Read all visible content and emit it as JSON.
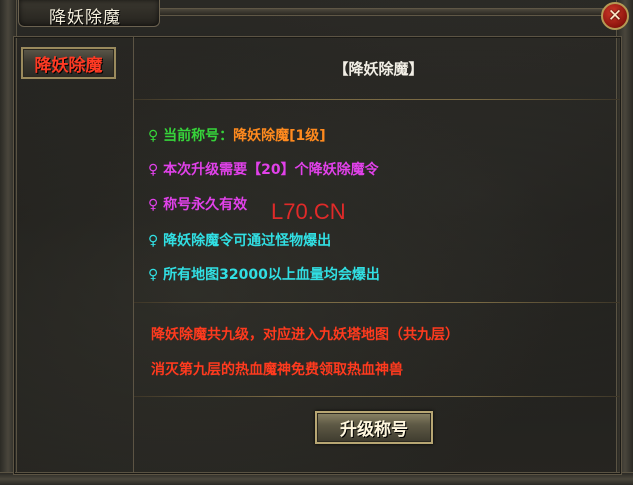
{
  "window": {
    "title": "降妖除魔",
    "close_label": "✕"
  },
  "sidebar": {
    "items": [
      {
        "label": "降妖除魔",
        "active": true
      }
    ]
  },
  "panel": {
    "heading": "【降妖除魔】",
    "lines": [
      {
        "icon": "♀",
        "prefix": "当前称号：",
        "value": "降妖除魔[1级]"
      },
      {
        "icon": "♀",
        "text": "本次升级需要【20】个降妖除魔令"
      },
      {
        "icon": "♀",
        "text": "称号永久有效"
      },
      {
        "icon": "♀",
        "text": "降妖除魔令可通过怪物爆出"
      },
      {
        "icon": "♀",
        "text": "所有地图32000以上血量均会爆出"
      }
    ],
    "notes": [
      "降妖除魔共九级，对应进入九妖塔地图（共九层）",
      "消灭第九层的热血魔神免费领取热血神兽"
    ],
    "watermark": "L70.CN",
    "upgrade_button": "升级称号"
  },
  "colors": {
    "green": "#36d33a",
    "orange": "#ff8a1e",
    "magenta": "#e141ea",
    "cyan": "#31dfe3",
    "red": "#ff3a1e"
  }
}
